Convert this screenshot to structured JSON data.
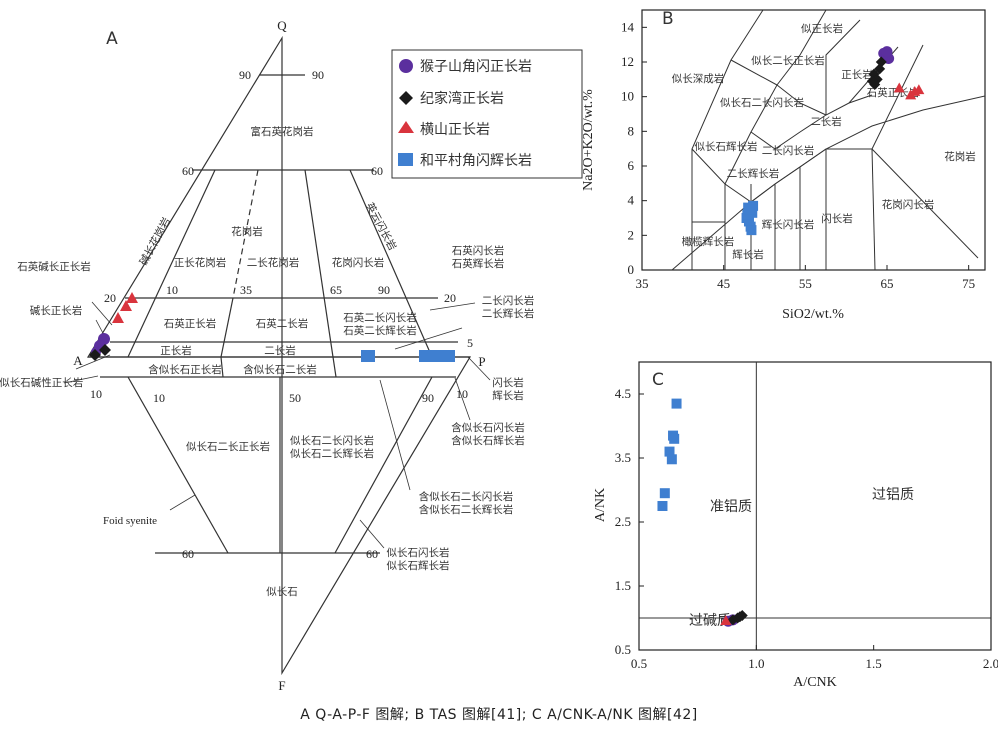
{
  "caption": "A Q-A-P-F 图解; B TAS 图解[41]; C A/CNK-A/NK 图解[42]",
  "legend": [
    {
      "name": "猴子山角闪正长岩",
      "marker": "circle",
      "color": "#5b2f9e"
    },
    {
      "name": "纪家湾正长岩",
      "marker": "diamond",
      "color": "#1a1a1a"
    },
    {
      "name": "横山正长岩",
      "marker": "triangle",
      "color": "#d9343d"
    },
    {
      "name": "和平村角闪辉长岩",
      "marker": "square",
      "color": "#3f7fd0"
    }
  ],
  "chart_data": [
    {
      "panel": "A",
      "type": "ternary",
      "vertices": [
        "Q",
        "A",
        "P",
        "F"
      ],
      "tick_labels": [
        "90",
        "90",
        "60",
        "60",
        "20",
        "20",
        "10",
        "35",
        "65",
        "90",
        "5",
        "10",
        "10",
        "50",
        "90",
        "10",
        "60",
        "60"
      ],
      "fields": [
        "富石英花岗岩",
        "花岗岩",
        "正长花岗岩",
        "二长花岗岩",
        "花岗闪长岩",
        "英云闪长岩",
        "碱长花岗岩",
        "石英碱长正长岩",
        "石英闪长岩",
        "石英辉长岩",
        "碱长正长岩",
        "石英正长岩",
        "石英二长岩",
        "石英二长闪长岩",
        "石英二长辉长岩",
        "二长闪长岩",
        "二长辉长岩",
        "正长岩",
        "二长岩",
        "含似长石正长岩",
        "含似长石二长岩",
        "含似长石碱性正长岩",
        "闪长岩",
        "辉长岩",
        "含似长石闪长岩",
        "含似长石辉长岩",
        "似长石二长正长岩",
        "似长石二长闪长岩",
        "似长石二长辉长岩",
        "含似长石二长闪长岩",
        "含似长石二长辉长岩",
        "Foid syenite",
        "似长石闪长岩",
        "似长石辉长岩",
        "似长石"
      ]
    },
    {
      "panel": "B",
      "type": "scatter",
      "xlabel": "SiO2/wt.%",
      "ylabel": "Na2O+K2O/wt.%",
      "xlim": [
        35,
        77
      ],
      "ylim": [
        0,
        15
      ],
      "xticks": [
        35,
        45,
        55,
        65,
        75
      ],
      "yticks": [
        0,
        2,
        4,
        6,
        8,
        10,
        12,
        14
      ],
      "fields": [
        "似正长岩",
        "似长深成岩",
        "似长二长正长岩",
        "正长岩",
        "石英正长岩",
        "似长石二长闪长岩",
        "二长岩",
        "似长石辉长岩",
        "二长闪长岩",
        "二长辉长岩",
        "橄榄辉长岩",
        "辉长岩",
        "辉长闪长岩",
        "闪长岩",
        "花岗闪长岩",
        "花岗岩"
      ],
      "series": [
        {
          "name": "猴子山角闪正长岩",
          "x": [
            64.6,
            64.9,
            65.2,
            65.0
          ],
          "y": [
            12.5,
            12.3,
            12.2,
            12.6
          ]
        },
        {
          "name": "纪家湾正长岩",
          "x": [
            63.4,
            63.8,
            64.1,
            63.5,
            64.3,
            63.2
          ],
          "y": [
            11.3,
            11.0,
            11.6,
            10.7,
            12.0,
            10.9
          ]
        },
        {
          "name": "横山正长岩",
          "x": [
            66.5,
            67.9,
            68.4,
            68.9
          ],
          "y": [
            10.5,
            10.1,
            10.3,
            10.4
          ]
        },
        {
          "name": "和平村角闪辉长岩",
          "x": [
            47.8,
            48.3,
            48.0,
            48.6,
            48.1,
            48.5,
            47.9,
            48.4,
            48.2
          ],
          "y": [
            3.0,
            2.5,
            3.6,
            3.7,
            2.8,
            3.3,
            3.2,
            2.3,
            3.5
          ]
        }
      ]
    },
    {
      "panel": "C",
      "type": "scatter",
      "xlabel": "A/CNK",
      "ylabel": "A/NK",
      "xlim": [
        0.5,
        2.0
      ],
      "ylim": [
        0.5,
        5.0
      ],
      "xticks": [
        0.5,
        1.0,
        1.5,
        2.0
      ],
      "yticks": [
        0.5,
        1.5,
        2.5,
        3.5,
        4.5
      ],
      "regions": [
        "准铝质",
        "过铝质",
        "过碱质"
      ],
      "series": [
        {
          "name": "猴子山角闪正长岩",
          "x": [
            0.88,
            0.9
          ],
          "y": [
            0.95,
            0.97
          ]
        },
        {
          "name": "纪家湾正长岩",
          "x": [
            0.9,
            0.92,
            0.93,
            0.94
          ],
          "y": [
            0.97,
            1.0,
            1.02,
            1.04
          ]
        },
        {
          "name": "横山正长岩",
          "x": [
            0.87
          ],
          "y": [
            0.96
          ]
        },
        {
          "name": "和平村角闪辉长岩",
          "x": [
            0.6,
            0.61,
            0.63,
            0.64,
            0.645,
            0.65,
            0.66
          ],
          "y": [
            2.75,
            2.95,
            3.6,
            3.48,
            3.85,
            3.8,
            4.35
          ]
        }
      ]
    }
  ]
}
